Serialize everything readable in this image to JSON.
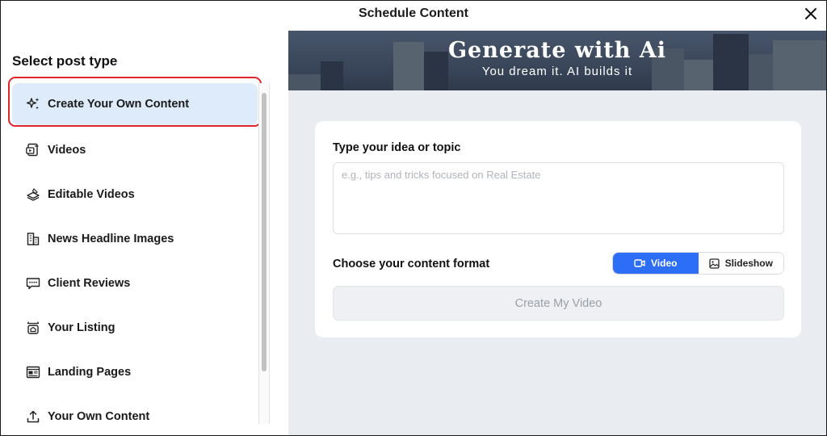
{
  "header": {
    "title": "Schedule Content"
  },
  "sidebar": {
    "heading": "Select post type",
    "items": [
      {
        "label": "Create Your Own Content",
        "icon": "sparkles-icon",
        "active": true
      },
      {
        "label": "Videos",
        "icon": "video-file-icon"
      },
      {
        "label": "Editable Videos",
        "icon": "editable-video-icon"
      },
      {
        "label": "News Headline Images",
        "icon": "building-icon"
      },
      {
        "label": "Client Reviews",
        "icon": "review-chat-icon"
      },
      {
        "label": "Your Listing",
        "icon": "house-listing-icon"
      },
      {
        "label": "Landing Pages",
        "icon": "landing-page-icon"
      },
      {
        "label": "Your Own Content",
        "icon": "upload-icon"
      }
    ]
  },
  "banner": {
    "title": "Generate with Ai",
    "subtitle": "You dream it. AI builds it"
  },
  "form": {
    "topic_label": "Type your idea or topic",
    "topic_placeholder": "e.g., tips and tricks focused on Real Estate",
    "topic_value": "",
    "format_label": "Choose your content format",
    "formats": [
      {
        "label": "Video",
        "icon": "video-camera-icon",
        "selected": true
      },
      {
        "label": "Slideshow",
        "icon": "image-icon",
        "selected": false
      }
    ],
    "create_button": "Create My Video"
  },
  "colors": {
    "accent": "#2d6ef6",
    "active_item_bg": "#deebfb",
    "highlight": "#e0262a",
    "panel_bg": "#e9ecf1"
  }
}
